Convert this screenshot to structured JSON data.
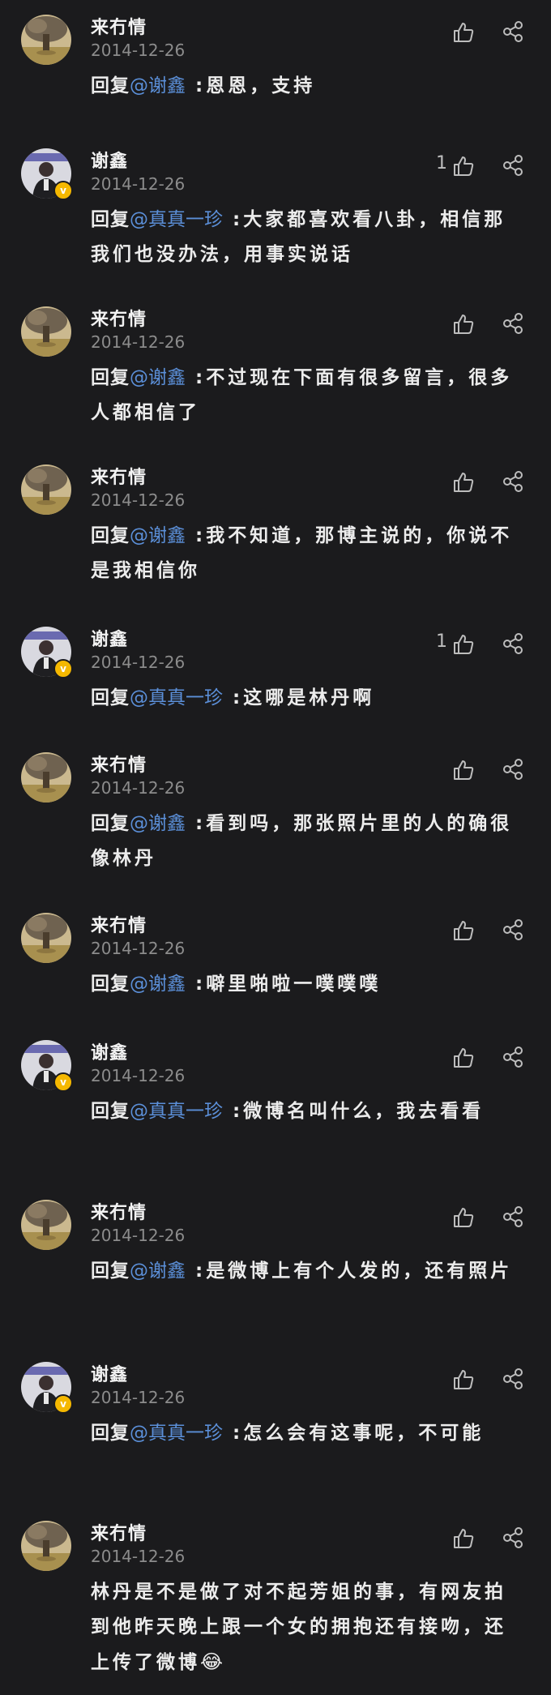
{
  "comments": [
    {
      "user": "来冇情",
      "date": "2014-12-26",
      "likes": "",
      "avatar": "tree",
      "prefix": "回复",
      "mention": "@谢鑫",
      "colon": " :",
      "body": "恩恩，支持"
    },
    {
      "user": "谢鑫",
      "date": "2014-12-26",
      "likes": "1",
      "avatar": "person",
      "prefix": "回复",
      "mention": "@真真一珍",
      "colon": " :",
      "body": "大家都喜欢看八卦，相信那我们也没办法，用事实说话"
    },
    {
      "user": "来冇情",
      "date": "2014-12-26",
      "likes": "",
      "avatar": "tree",
      "prefix": "回复",
      "mention": "@谢鑫",
      "colon": " :",
      "body": "不过现在下面有很多留言，很多人都相信了"
    },
    {
      "user": "来冇情",
      "date": "2014-12-26",
      "likes": "",
      "avatar": "tree",
      "prefix": "回复",
      "mention": "@谢鑫",
      "colon": " :",
      "body": "我不知道，那博主说的，你说不是我相信你"
    },
    {
      "user": "谢鑫",
      "date": "2014-12-26",
      "likes": "1",
      "avatar": "person",
      "prefix": "回复",
      "mention": "@真真一珍",
      "colon": " :",
      "body": "这哪是林丹啊"
    },
    {
      "user": "来冇情",
      "date": "2014-12-26",
      "likes": "",
      "avatar": "tree",
      "prefix": "回复",
      "mention": "@谢鑫",
      "colon": " :",
      "body": "看到吗，那张照片里的人的确很像林丹"
    },
    {
      "user": "来冇情",
      "date": "2014-12-26",
      "likes": "",
      "avatar": "tree",
      "prefix": "回复",
      "mention": "@谢鑫",
      "colon": " :",
      "body": "噼里啪啦一噗噗噗"
    },
    {
      "user": "谢鑫",
      "date": "2014-12-26",
      "likes": "",
      "avatar": "person",
      "prefix": "回复",
      "mention": "@真真一珍",
      "colon": " :",
      "body": "微博名叫什么，我去看看"
    },
    {
      "user": "来冇情",
      "date": "2014-12-26",
      "likes": "",
      "avatar": "tree",
      "prefix": "回复",
      "mention": "@谢鑫",
      "colon": " :",
      "body": "是微博上有个人发的，还有照片"
    },
    {
      "user": "谢鑫",
      "date": "2014-12-26",
      "likes": "",
      "avatar": "person",
      "prefix": "回复",
      "mention": "@真真一珍",
      "colon": " :",
      "body": "怎么会有这事呢，不可能"
    },
    {
      "user": "来冇情",
      "date": "2014-12-26",
      "likes": "",
      "avatar": "tree",
      "prefix": "",
      "mention": "",
      "colon": "",
      "body": "林丹是不是做了对不起芳姐的事，有网友拍到他昨天晚上跟一个女的拥抱还有接吻，还上传了微博",
      "emoji": "😂"
    }
  ],
  "badge_symbol": "v",
  "icons": {
    "like": "thumbs-up-icon",
    "share": "share-icon"
  },
  "colors": {
    "background": "#1b1b1d",
    "mention": "#5b8fd8",
    "date": "#8c8c8c",
    "badge": "#f5b800"
  }
}
